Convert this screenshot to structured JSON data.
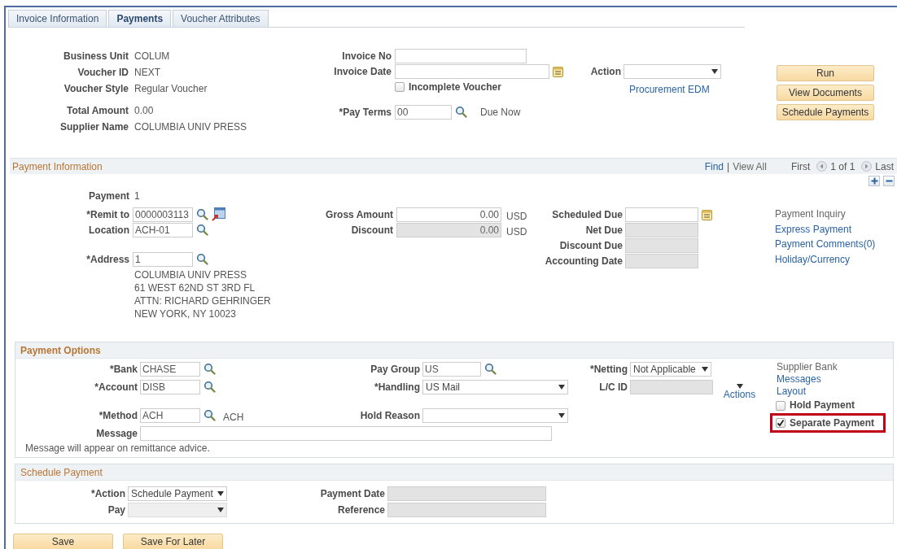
{
  "tabs": [
    {
      "label": "Invoice Information",
      "selected": false
    },
    {
      "label": "Payments",
      "selected": true
    },
    {
      "label": "Voucher Attributes",
      "selected": false
    }
  ],
  "header": {
    "left": [
      {
        "label": "Business Unit",
        "value": "COLUM"
      },
      {
        "label": "Voucher ID",
        "value": "NEXT"
      },
      {
        "label": "Voucher Style",
        "value": "Regular Voucher"
      },
      {
        "label": "Total Amount",
        "value": "0.00"
      },
      {
        "label": "Supplier Name",
        "value": "COLUMBIA UNIV PRESS"
      }
    ],
    "invoice_no": {
      "label": "Invoice No"
    },
    "invoice_date": {
      "label": "Invoice Date"
    },
    "incomplete_voucher": {
      "label": "Incomplete Voucher",
      "checked": false
    },
    "pay_terms": {
      "label": "*Pay Terms",
      "value": "00",
      "description": "Due Now"
    },
    "action": {
      "label": "Action"
    },
    "link": "Procurement EDM",
    "buttons": [
      "Run",
      "View Documents",
      "Schedule Payments"
    ]
  },
  "payment_information": {
    "title": "Payment Information",
    "find": "Find",
    "separator": "|",
    "view_all": "View All",
    "first": "First",
    "count": "1 of 1",
    "last": "Last",
    "payment": {
      "label": "Payment",
      "value": "1"
    },
    "remit_to": {
      "label": "*Remit to",
      "value": "0000003113"
    },
    "location": {
      "label": "Location",
      "value": "ACH-01"
    },
    "address": {
      "label": "*Address",
      "value": "1",
      "lines": [
        "COLUMBIA UNIV PRESS",
        "61 WEST 62ND ST 3RD FL",
        "ATTN: RICHARD GEHRINGER",
        "NEW YORK, NY  10023"
      ]
    },
    "amounts": [
      {
        "label": "Gross Amount",
        "value": "0.00",
        "currency": "USD",
        "disabled": false
      },
      {
        "label": "Discount",
        "value": "0.00",
        "currency": "USD",
        "disabled": true
      }
    ],
    "dates": [
      {
        "label": "Scheduled Due",
        "disabled": false
      },
      {
        "label": "Net Due",
        "disabled": true
      },
      {
        "label": "Discount Due",
        "disabled": true
      },
      {
        "label": "Accounting Date",
        "disabled": true
      }
    ],
    "links": [
      {
        "text": "Payment Inquiry",
        "disabled": true
      },
      {
        "text": "Express Payment",
        "disabled": false
      },
      {
        "text": "Payment Comments(0)",
        "disabled": false
      },
      {
        "text": "Holiday/Currency",
        "disabled": false
      }
    ]
  },
  "payment_options": {
    "title": "Payment Options",
    "bank": {
      "label": "*Bank",
      "value": "CHASE"
    },
    "account": {
      "label": "*Account",
      "value": "DISB"
    },
    "method": {
      "label": "*Method",
      "value": "ACH",
      "description": "ACH"
    },
    "message": {
      "label": "Message"
    },
    "note": "Message will appear on remittance advice.",
    "pay_group": {
      "label": "Pay Group",
      "value": "US"
    },
    "handling": {
      "label": "*Handling",
      "value": "US Mail"
    },
    "hold_reason": {
      "label": "Hold Reason"
    },
    "netting": {
      "label": "*Netting",
      "value": "Not Applicable"
    },
    "lc_id": {
      "label": "L/C ID"
    },
    "actions": "Actions",
    "links": [
      {
        "text": "Supplier Bank",
        "disabled": true
      },
      {
        "text": "Messages",
        "disabled": false
      },
      {
        "text": "Layout",
        "disabled": false
      }
    ],
    "checkboxes": [
      {
        "label": "Hold Payment",
        "checked": false,
        "highlighted": false
      },
      {
        "label": "Separate Payment",
        "checked": true,
        "highlighted": true
      }
    ]
  },
  "schedule_payment": {
    "title": "Schedule Payment",
    "action": {
      "label": "*Action",
      "value": "Schedule Payment"
    },
    "pay": {
      "label": "Pay"
    },
    "payment_date": {
      "label": "Payment Date"
    },
    "reference": {
      "label": "Reference"
    }
  },
  "footer_buttons": [
    "Save",
    "Save For Later"
  ]
}
